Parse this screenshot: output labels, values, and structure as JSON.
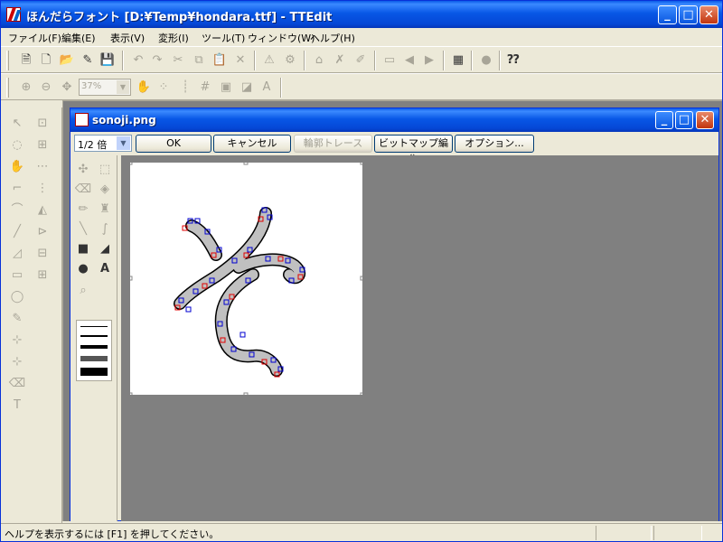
{
  "window": {
    "title": "ほんだらフォント [D:¥Temp¥hondara.ttf] - TTEdit",
    "controls": {
      "minimize": "_",
      "maximize": "□",
      "close": "✕"
    }
  },
  "menu": [
    "ファイル(F)",
    "編集(E)",
    "表示(V)",
    "変形(I)",
    "ツール(T)",
    "ウィンドウ(W)",
    "ヘルプ(H)"
  ],
  "toolbar2": {
    "zoom_value": "37%"
  },
  "child_window": {
    "title": "sonoji.png",
    "scale_select": "1/2 倍",
    "buttons": {
      "ok": "OK",
      "cancel": "キャンセル",
      "trace": "輪郭トレース",
      "bitmap_edit": "ビットマップ編集",
      "options": "オプション..."
    }
  },
  "status": {
    "text": "ヘルプを表示するには [F1] を押してください。"
  },
  "colors": {
    "accent": "#0a56e0",
    "outline_red": "#e00000",
    "point_blue": "#0000d0",
    "glyph_fill": "#c0c0c0"
  }
}
